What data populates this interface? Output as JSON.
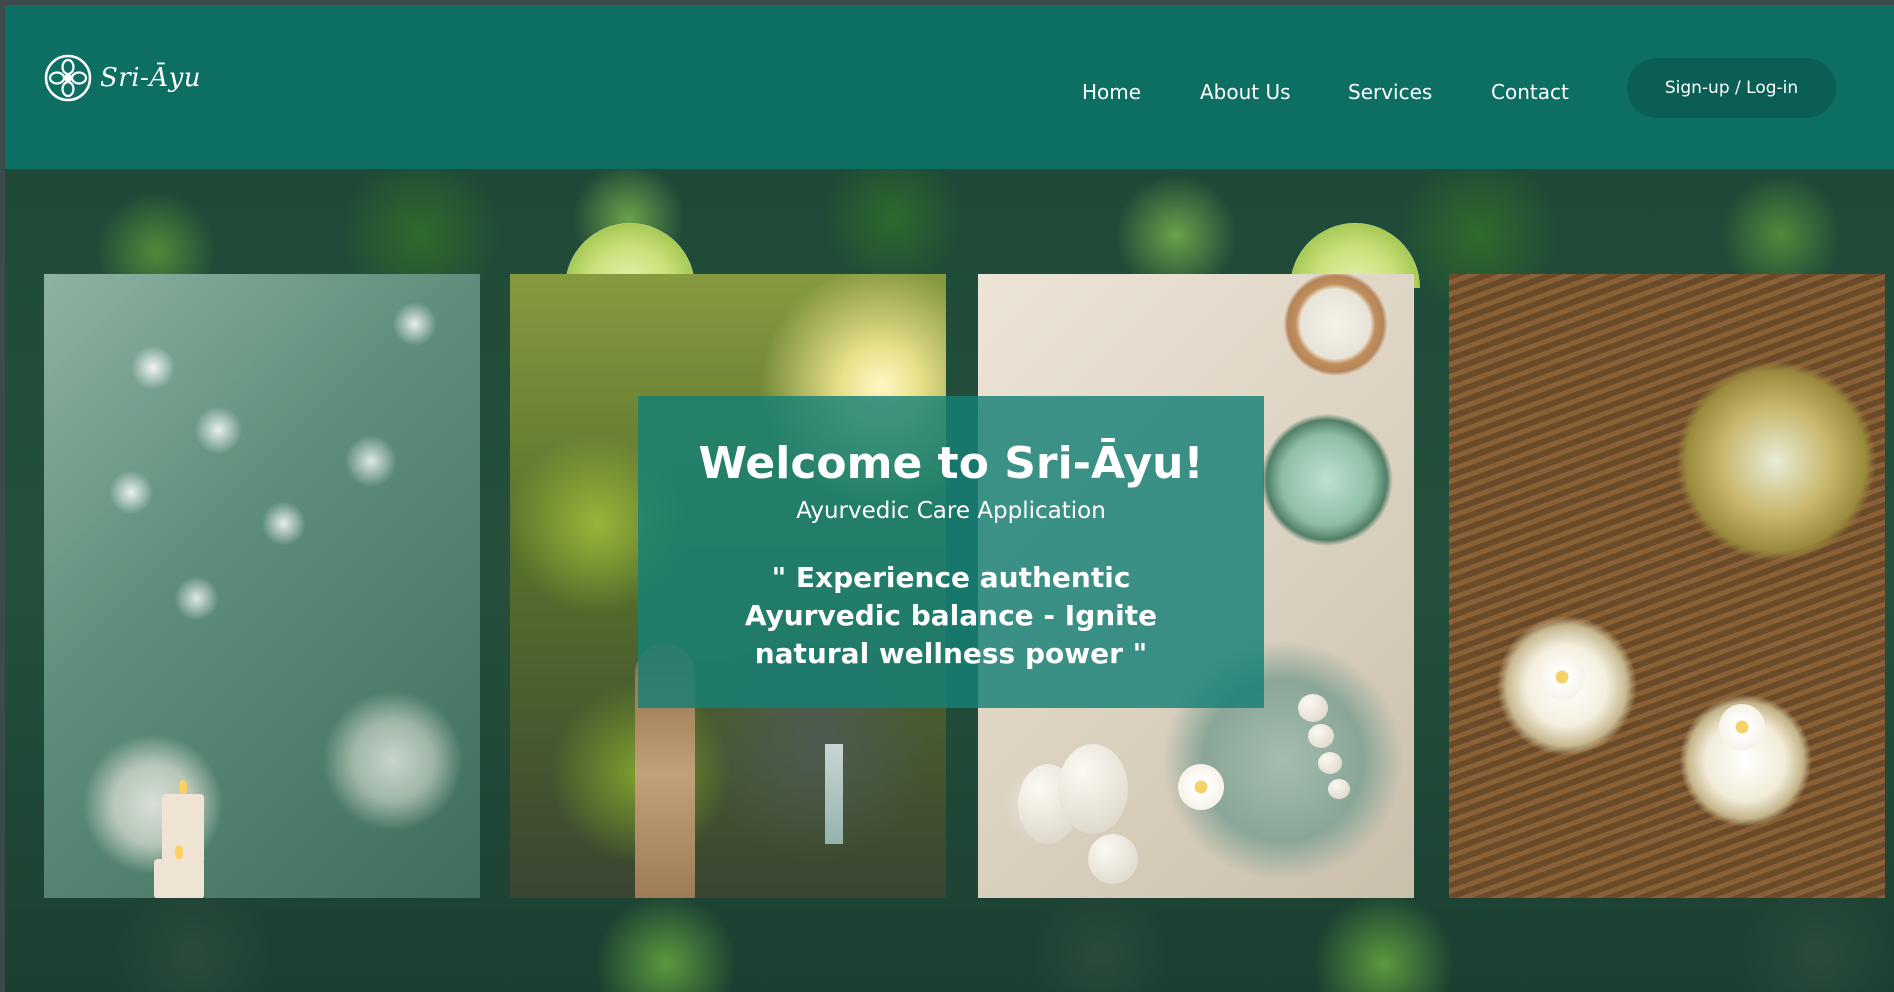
{
  "header": {
    "logo_text": "Sri-Āyu",
    "logo_icon": "lotus-flower-icon"
  },
  "nav": {
    "items": [
      {
        "label": "Home"
      },
      {
        "label": "About Us"
      },
      {
        "label": "Services"
      },
      {
        "label": "Contact"
      }
    ],
    "auth_label": "Sign-up / Log-in"
  },
  "hero": {
    "title": "Welcome to Sri-Āyu!",
    "subtitle": "Ayurvedic Care Application",
    "tagline": "\" Experience authentic Ayurvedic balance - Ignite natural wellness power \""
  },
  "colors": {
    "primary": "#0c6f62",
    "button": "#0b5e54",
    "card_overlay": "#168076"
  }
}
